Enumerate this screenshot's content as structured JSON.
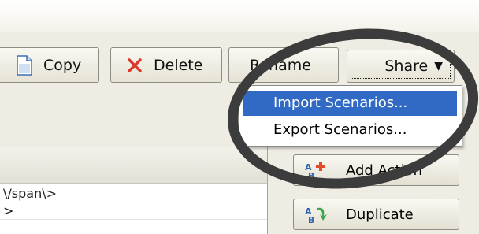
{
  "toolbar": {
    "copy_label": "Copy",
    "delete_label": "Delete",
    "rename_label": "Rename",
    "share_label": "Share"
  },
  "share_menu": {
    "items": [
      "Import Scenarios...",
      "Export Scenarios..."
    ],
    "selected_index": 0
  },
  "list": {
    "rows": [
      "\\/span\\>",
      ">"
    ]
  },
  "side_buttons": {
    "add_action_label": "Add Action",
    "duplicate_label": "Duplicate"
  },
  "icons": [
    "copy-icon",
    "delete-icon",
    "chevron-down-icon",
    "add-action-icon",
    "duplicate-icon"
  ],
  "colors": {
    "menu_highlight": "#316ac5",
    "delete_red": "#d93a2a",
    "panel_background": "#efede3",
    "callout_oval": "#3c3c3c"
  }
}
